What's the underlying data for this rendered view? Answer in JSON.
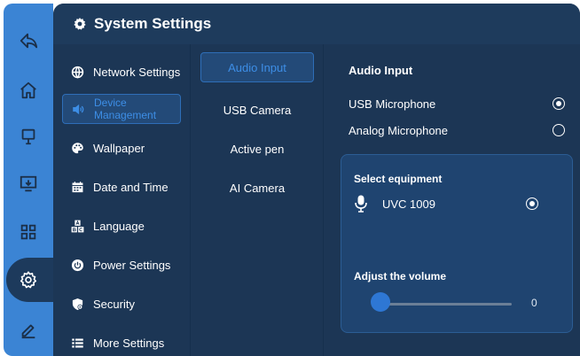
{
  "dock": {
    "items": [
      {
        "icon": "back-icon"
      },
      {
        "icon": "home-icon"
      },
      {
        "icon": "whiteboard-icon"
      },
      {
        "icon": "screen-share-icon"
      },
      {
        "icon": "apps-grid-icon"
      },
      {
        "icon": "gear-icon",
        "active": true
      },
      {
        "icon": "pen-icon"
      }
    ]
  },
  "header": {
    "title": "System Settings"
  },
  "menu": {
    "items": [
      {
        "label": "Network Settings",
        "icon": "globe-icon"
      },
      {
        "label": "Device\nManagement",
        "icon": "speaker-icon",
        "selected": true
      },
      {
        "label": "Wallpaper",
        "icon": "palette-icon"
      },
      {
        "label": "Date and Time",
        "icon": "calendar-icon"
      },
      {
        "label": "Language",
        "icon": "language-icon"
      },
      {
        "label": "Power Settings",
        "icon": "power-icon"
      },
      {
        "label": "Security",
        "icon": "shield-icon"
      },
      {
        "label": "More Settings",
        "icon": "list-icon"
      }
    ]
  },
  "submenu": {
    "items": [
      {
        "label": "Audio Input",
        "selected": true
      },
      {
        "label": "USB Camera"
      },
      {
        "label": "Active pen"
      },
      {
        "label": "AI Camera"
      }
    ]
  },
  "detail": {
    "heading": "Audio Input",
    "options": [
      {
        "label": "USB Microphone",
        "selected": true
      },
      {
        "label": "Analog Microphone",
        "selected": false
      }
    ],
    "card": {
      "equipment_heading": "Select equipment",
      "device_name": "UVC 1009",
      "device_selected": true,
      "volume_heading": "Adjust the volume",
      "volume_value": "0",
      "volume_fraction": 0
    }
  },
  "colors": {
    "dock": "#3b84d4",
    "panel": "#1c3655",
    "accent": "#3d8ee6",
    "card": "#1f4470"
  }
}
